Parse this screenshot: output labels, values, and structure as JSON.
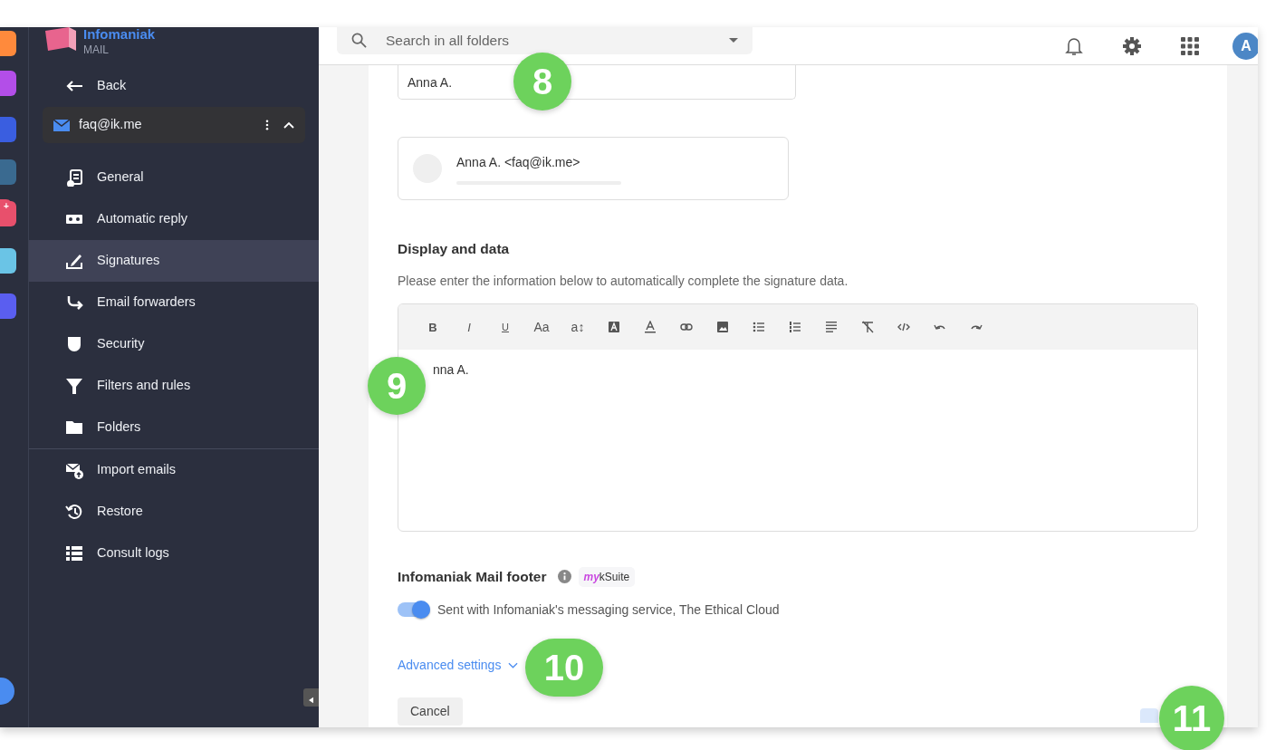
{
  "rail": {
    "badge": "+"
  },
  "app": {
    "name": "Infomaniak",
    "product": "MAIL"
  },
  "nav": {
    "back": "Back",
    "account": "faq@ik.me",
    "expanded": true,
    "items": [
      {
        "label": "General",
        "selected": false
      },
      {
        "label": "Automatic reply",
        "selected": false
      },
      {
        "label": "Signatures",
        "selected": true
      },
      {
        "label": "Email forwarders",
        "selected": false
      },
      {
        "label": "Security",
        "selected": false
      },
      {
        "label": "Filters and rules",
        "selected": false
      },
      {
        "label": "Folders",
        "selected": false
      }
    ],
    "tools": [
      {
        "label": "Import emails",
        "selected": false
      },
      {
        "label": "Restore",
        "selected": false
      },
      {
        "label": "Consult logs",
        "selected": false
      }
    ]
  },
  "search": {
    "placeholder": "Search in all folders"
  },
  "avatar": "A",
  "name_field": {
    "value": "Anna A."
  },
  "preview": {
    "sender": "Anna A. <faq@ik.me>"
  },
  "display": {
    "title": "Display and data",
    "description": "Please enter the information below to automatically complete the signature data."
  },
  "editor": {
    "text_tools": [
      "B",
      "I",
      "U",
      "Aa",
      "a↕"
    ],
    "content": "nna A."
  },
  "footer": {
    "title": "Infomaniak Mail footer",
    "badge_prefix": "my",
    "badge_name": "kSuite",
    "toggle_on": true,
    "toggle_label": "Sent with Infomaniak's messaging service, The Ethical Cloud"
  },
  "advanced": "Advanced settings",
  "cancel": "Cancel",
  "callouts": [
    "8",
    "9",
    "10",
    "11"
  ]
}
